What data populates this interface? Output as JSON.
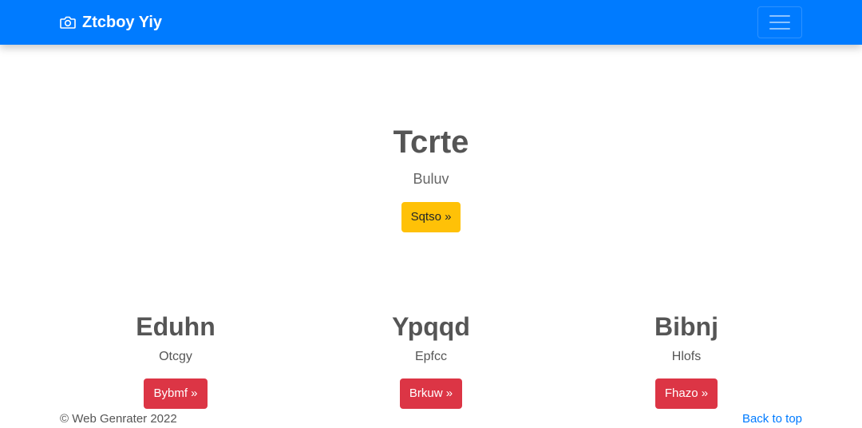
{
  "navbar": {
    "brand_icon": "camera-icon",
    "brand_text": "Ztcboy Yiy",
    "toggler_icon": "hamburger-icon",
    "color": "#007bff"
  },
  "hero": {
    "title": "Tcrte",
    "subtitle": "Buluv",
    "button_label": "Sqtso »",
    "button_color": "#ffc107"
  },
  "features": [
    {
      "title": "Eduhn",
      "text": "Otcgy",
      "button_label": "Bybmf »"
    },
    {
      "title": "Ypqqd",
      "text": "Epfcc",
      "button_label": "Brkuw »"
    },
    {
      "title": "Bibnj",
      "text": "Hlofs",
      "button_label": "Fhazo »"
    }
  ],
  "feature_button_color": "#dc3545",
  "footer": {
    "copyright": "© Web Genrater 2022",
    "back_to_top": "Back to top"
  }
}
